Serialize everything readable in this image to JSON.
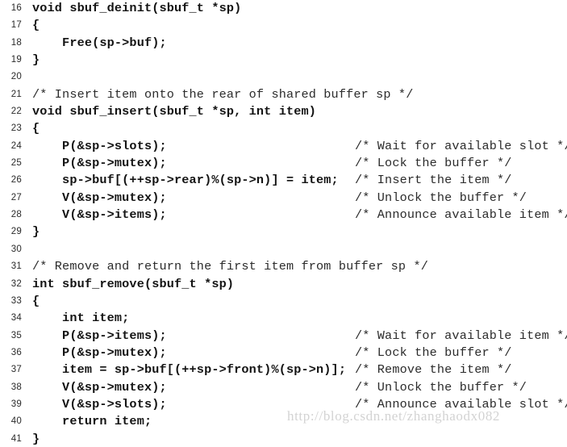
{
  "page": {
    "background_color": "#ffffff",
    "text_color": "#131313",
    "comment_color": "#2b2b2b",
    "line_number_color": "#2a2a2a",
    "watermark_color": "#d3d3d3"
  },
  "watermark": {
    "text": "http://blog.csdn.net/zhanghaodx082"
  },
  "listing": {
    "first_line_number": 16,
    "last_line_number": 41,
    "lines": [
      {
        "number": "16",
        "code": "void sbuf_deinit(sbuf_t *sp)",
        "comment": "",
        "is_comment_line": false
      },
      {
        "number": "17",
        "code": "{",
        "comment": "",
        "is_comment_line": false
      },
      {
        "number": "18",
        "code": "    Free(sp->buf);",
        "comment": "",
        "is_comment_line": false
      },
      {
        "number": "19",
        "code": "}",
        "comment": "",
        "is_comment_line": false
      },
      {
        "number": "20",
        "code": "",
        "comment": "",
        "is_comment_line": false
      },
      {
        "number": "21",
        "code": "/* Insert item onto the rear of shared buffer sp */",
        "comment": "",
        "is_comment_line": true
      },
      {
        "number": "22",
        "code": "void sbuf_insert(sbuf_t *sp, int item)",
        "comment": "",
        "is_comment_line": false
      },
      {
        "number": "23",
        "code": "{",
        "comment": "",
        "is_comment_line": false
      },
      {
        "number": "24",
        "code": "    P(&sp->slots);",
        "comment": "/* Wait for available slot */",
        "is_comment_line": false
      },
      {
        "number": "25",
        "code": "    P(&sp->mutex);",
        "comment": "/* Lock the buffer */",
        "is_comment_line": false
      },
      {
        "number": "26",
        "code": "    sp->buf[(++sp->rear)%(sp->n)] = item;",
        "comment": "/* Insert the item */",
        "is_comment_line": false
      },
      {
        "number": "27",
        "code": "    V(&sp->mutex);",
        "comment": "/* Unlock the buffer */",
        "is_comment_line": false
      },
      {
        "number": "28",
        "code": "    V(&sp->items);",
        "comment": "/* Announce available item */",
        "is_comment_line": false
      },
      {
        "number": "29",
        "code": "}",
        "comment": "",
        "is_comment_line": false
      },
      {
        "number": "30",
        "code": "",
        "comment": "",
        "is_comment_line": false
      },
      {
        "number": "31",
        "code": "/* Remove and return the first item from buffer sp */",
        "comment": "",
        "is_comment_line": true
      },
      {
        "number": "32",
        "code": "int sbuf_remove(sbuf_t *sp)",
        "comment": "",
        "is_comment_line": false
      },
      {
        "number": "33",
        "code": "{",
        "comment": "",
        "is_comment_line": false
      },
      {
        "number": "34",
        "code": "    int item;",
        "comment": "",
        "is_comment_line": false
      },
      {
        "number": "35",
        "code": "    P(&sp->items);",
        "comment": "/* Wait for available item */",
        "is_comment_line": false
      },
      {
        "number": "36",
        "code": "    P(&sp->mutex);",
        "comment": "/* Lock the buffer */",
        "is_comment_line": false
      },
      {
        "number": "37",
        "code": "    item = sp->buf[(++sp->front)%(sp->n)];",
        "comment": "/* Remove the item */",
        "is_comment_line": false
      },
      {
        "number": "38",
        "code": "    V(&sp->mutex);",
        "comment": "/* Unlock the buffer */",
        "is_comment_line": false
      },
      {
        "number": "39",
        "code": "    V(&sp->slots);",
        "comment": "/* Announce available slot */",
        "is_comment_line": false
      },
      {
        "number": "40",
        "code": "    return item;",
        "comment": "",
        "is_comment_line": false
      },
      {
        "number": "41",
        "code": "}",
        "comment": "",
        "is_comment_line": false
      }
    ]
  }
}
